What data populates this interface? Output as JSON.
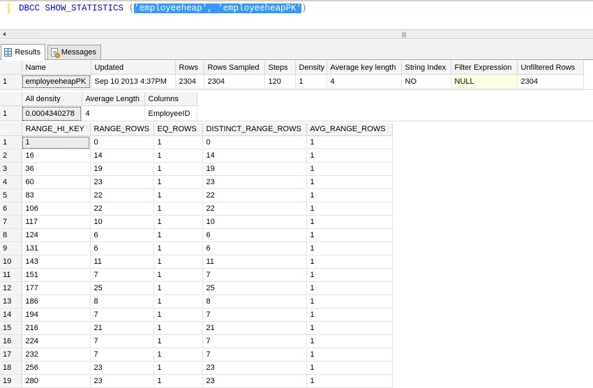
{
  "editor": {
    "keyword": "DBCC SHOW_STATISTICS",
    "open_paren": "(",
    "argument": "'employeeheap', 'employeeheapPK'",
    "close_paren": ")"
  },
  "tabs": [
    {
      "label": "Results",
      "icon": "grid-icon",
      "active": true
    },
    {
      "label": "Messages",
      "icon": "messages-icon",
      "active": false
    }
  ],
  "header_grid": {
    "columns": [
      "Name",
      "Updated",
      "Rows",
      "Rows Sampled",
      "Steps",
      "Density",
      "Average key length",
      "String Index",
      "Filter Expression",
      "Unfiltered Rows"
    ],
    "rows": [
      {
        "num": "1",
        "cells": [
          "employeeheapPK",
          "Sep 10 2013  4:37PM",
          "2304",
          "2304",
          "120",
          "1",
          "4",
          "NO",
          "NULL",
          "2304"
        ]
      }
    ]
  },
  "density_grid": {
    "columns": [
      "All density",
      "Average Length",
      "Columns"
    ],
    "rows": [
      {
        "num": "1",
        "cells": [
          "0.0004340278",
          "4",
          "EmployeeID"
        ]
      }
    ]
  },
  "histogram_grid": {
    "columns": [
      "RANGE_HI_KEY",
      "RANGE_ROWS",
      "EQ_ROWS",
      "DISTINCT_RANGE_ROWS",
      "AVG_RANGE_ROWS"
    ],
    "rows": [
      {
        "num": "1",
        "cells": [
          "1",
          "0",
          "1",
          "0",
          "1"
        ]
      },
      {
        "num": "2",
        "cells": [
          "16",
          "14",
          "1",
          "14",
          "1"
        ]
      },
      {
        "num": "3",
        "cells": [
          "36",
          "19",
          "1",
          "19",
          "1"
        ]
      },
      {
        "num": "4",
        "cells": [
          "60",
          "23",
          "1",
          "23",
          "1"
        ]
      },
      {
        "num": "5",
        "cells": [
          "83",
          "22",
          "1",
          "22",
          "1"
        ]
      },
      {
        "num": "6",
        "cells": [
          "106",
          "22",
          "1",
          "22",
          "1"
        ]
      },
      {
        "num": "7",
        "cells": [
          "117",
          "10",
          "1",
          "10",
          "1"
        ]
      },
      {
        "num": "8",
        "cells": [
          "124",
          "6",
          "1",
          "6",
          "1"
        ]
      },
      {
        "num": "9",
        "cells": [
          "131",
          "6",
          "1",
          "6",
          "1"
        ]
      },
      {
        "num": "10",
        "cells": [
          "143",
          "11",
          "1",
          "11",
          "1"
        ]
      },
      {
        "num": "11",
        "cells": [
          "151",
          "7",
          "1",
          "7",
          "1"
        ]
      },
      {
        "num": "12",
        "cells": [
          "177",
          "25",
          "1",
          "25",
          "1"
        ]
      },
      {
        "num": "13",
        "cells": [
          "186",
          "8",
          "1",
          "8",
          "1"
        ]
      },
      {
        "num": "14",
        "cells": [
          "194",
          "7",
          "1",
          "7",
          "1"
        ]
      },
      {
        "num": "15",
        "cells": [
          "216",
          "21",
          "1",
          "21",
          "1"
        ]
      },
      {
        "num": "16",
        "cells": [
          "224",
          "7",
          "1",
          "7",
          "1"
        ]
      },
      {
        "num": "17",
        "cells": [
          "232",
          "7",
          "1",
          "7",
          "1"
        ]
      },
      {
        "num": "18",
        "cells": [
          "256",
          "23",
          "1",
          "23",
          "1"
        ]
      },
      {
        "num": "19",
        "cells": [
          "280",
          "23",
          "1",
          "23",
          "1"
        ]
      }
    ]
  }
}
